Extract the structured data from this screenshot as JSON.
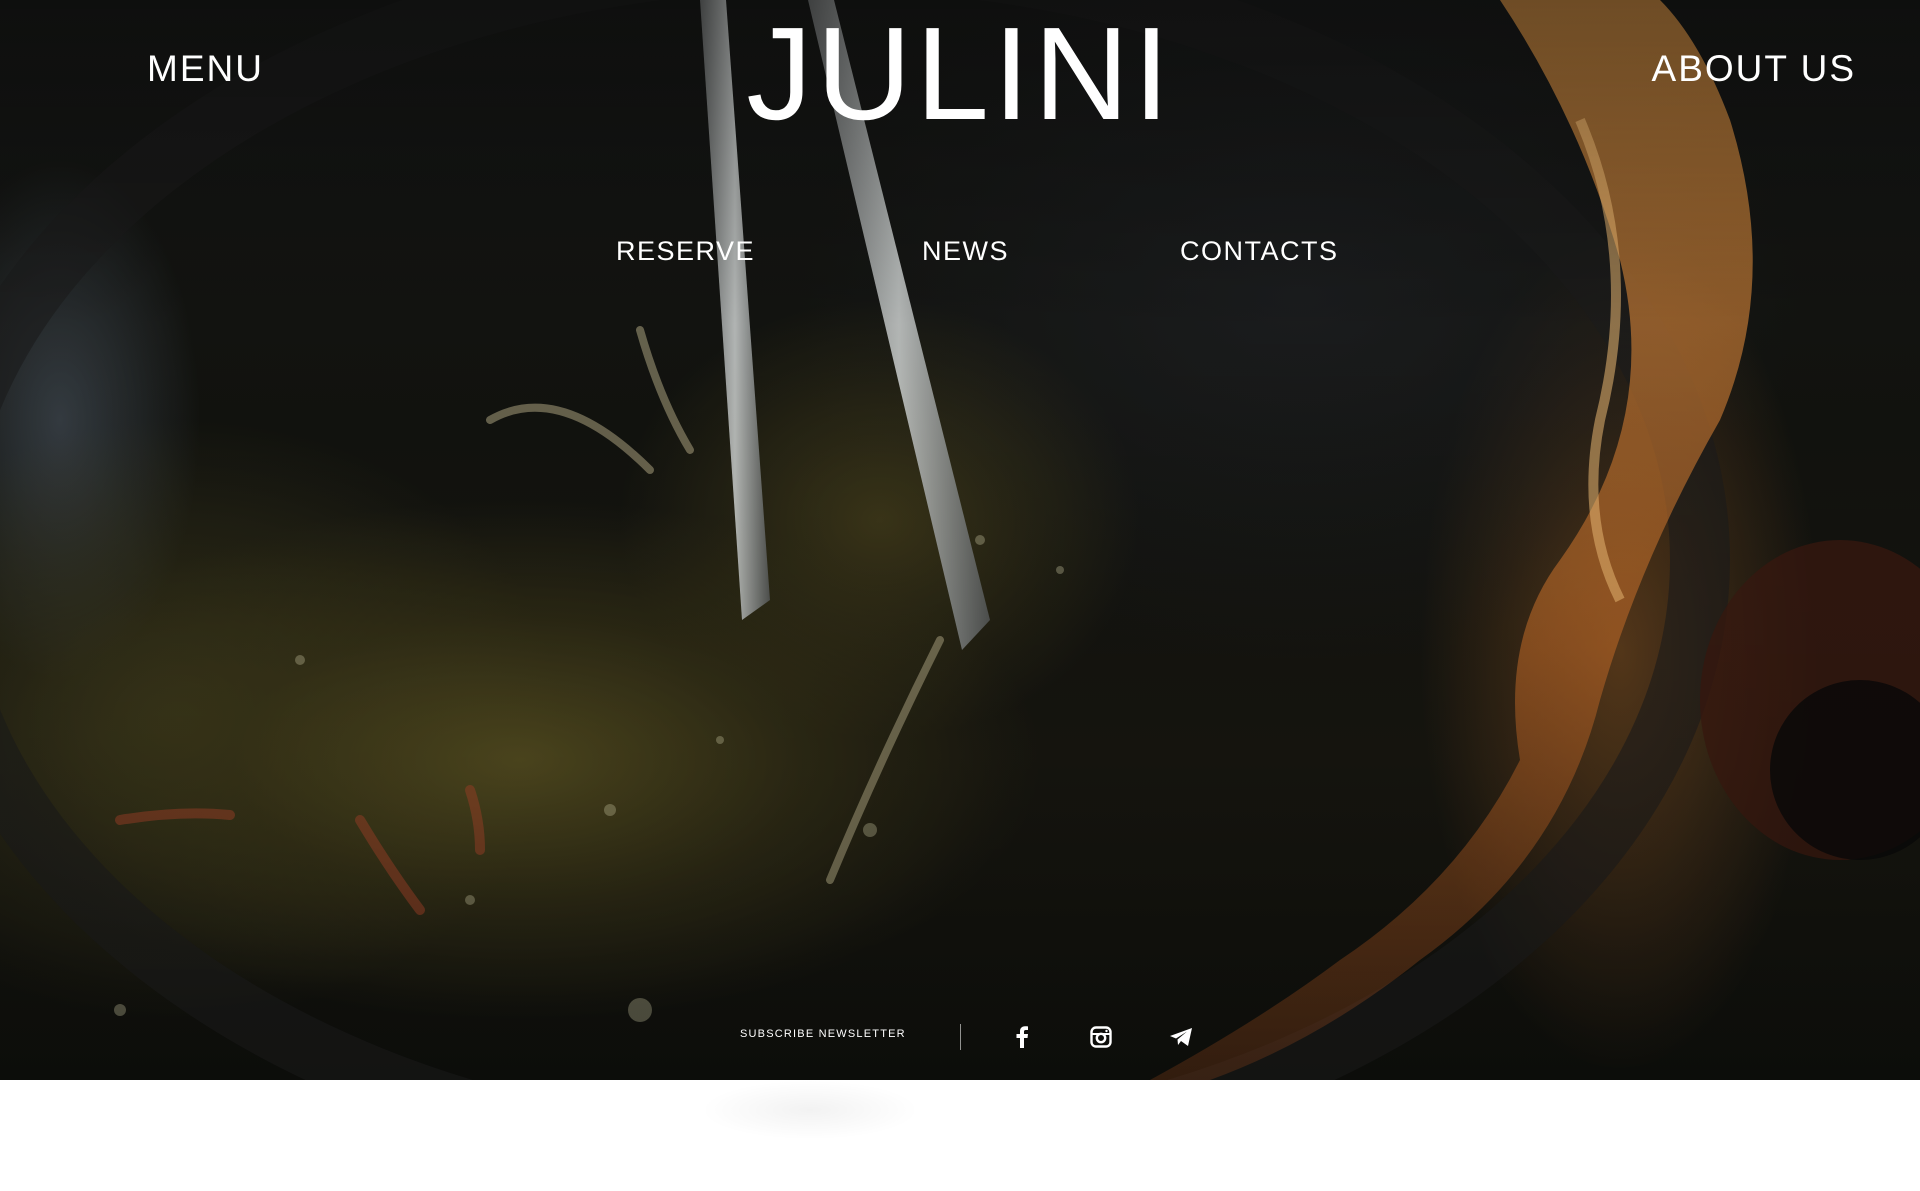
{
  "header": {
    "menu_label": "MENU",
    "logo_text": "JULINI",
    "about_label": "ABOUT US"
  },
  "subnav": {
    "items": [
      {
        "label": "RESERVE"
      },
      {
        "label": "NEWS"
      },
      {
        "label": "CONTACTS"
      }
    ]
  },
  "footer": {
    "subscribe_label": "SUBSCRIBE NEWSLETTER",
    "social_icons": [
      "facebook-icon",
      "instagram-icon",
      "telegram-icon"
    ]
  },
  "colors": {
    "text": "#ffffff",
    "flame": "#e08a3c",
    "page_background": "#ffffff"
  }
}
